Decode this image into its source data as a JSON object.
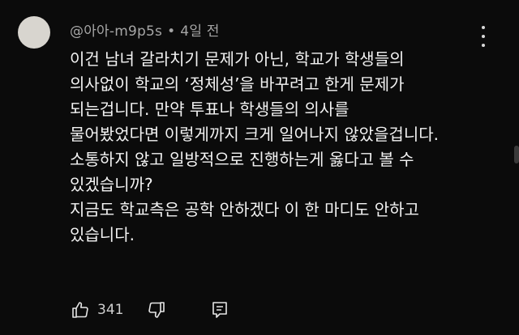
{
  "comment": {
    "author": "@아아-m9p5s",
    "separator": "•",
    "timestamp": "4일 전",
    "lines": [
      "이건 남녀 갈라치기 문제가 아닌, 학교가 학생들의",
      "의사없이 학교의 ‘정체성’을 바꾸려고 한게 문제가",
      "되는겁니다. 만약 투표나 학생들의 의사를",
      "물어봤었다면 이렇게까지 크게 일어나지 않았을겁니다.",
      "소통하지 않고 일방적으로 진행하는게 옳다고 볼 수",
      "있겠습니까?",
      "지금도 학교측은 공학 안하겠다 이 한 마디도 안하고",
      "있습니다."
    ],
    "like_count": "341"
  },
  "icons": {
    "like": "thumbs-up-icon",
    "dislike": "thumbs-down-icon",
    "reply": "reply-comment-icon",
    "menu": "more-vert-icon"
  },
  "colors": {
    "background": "#0b0b0b",
    "text": "#f3f3f3",
    "meta": "#a6a6a6",
    "avatar": "#d8d5cf"
  }
}
